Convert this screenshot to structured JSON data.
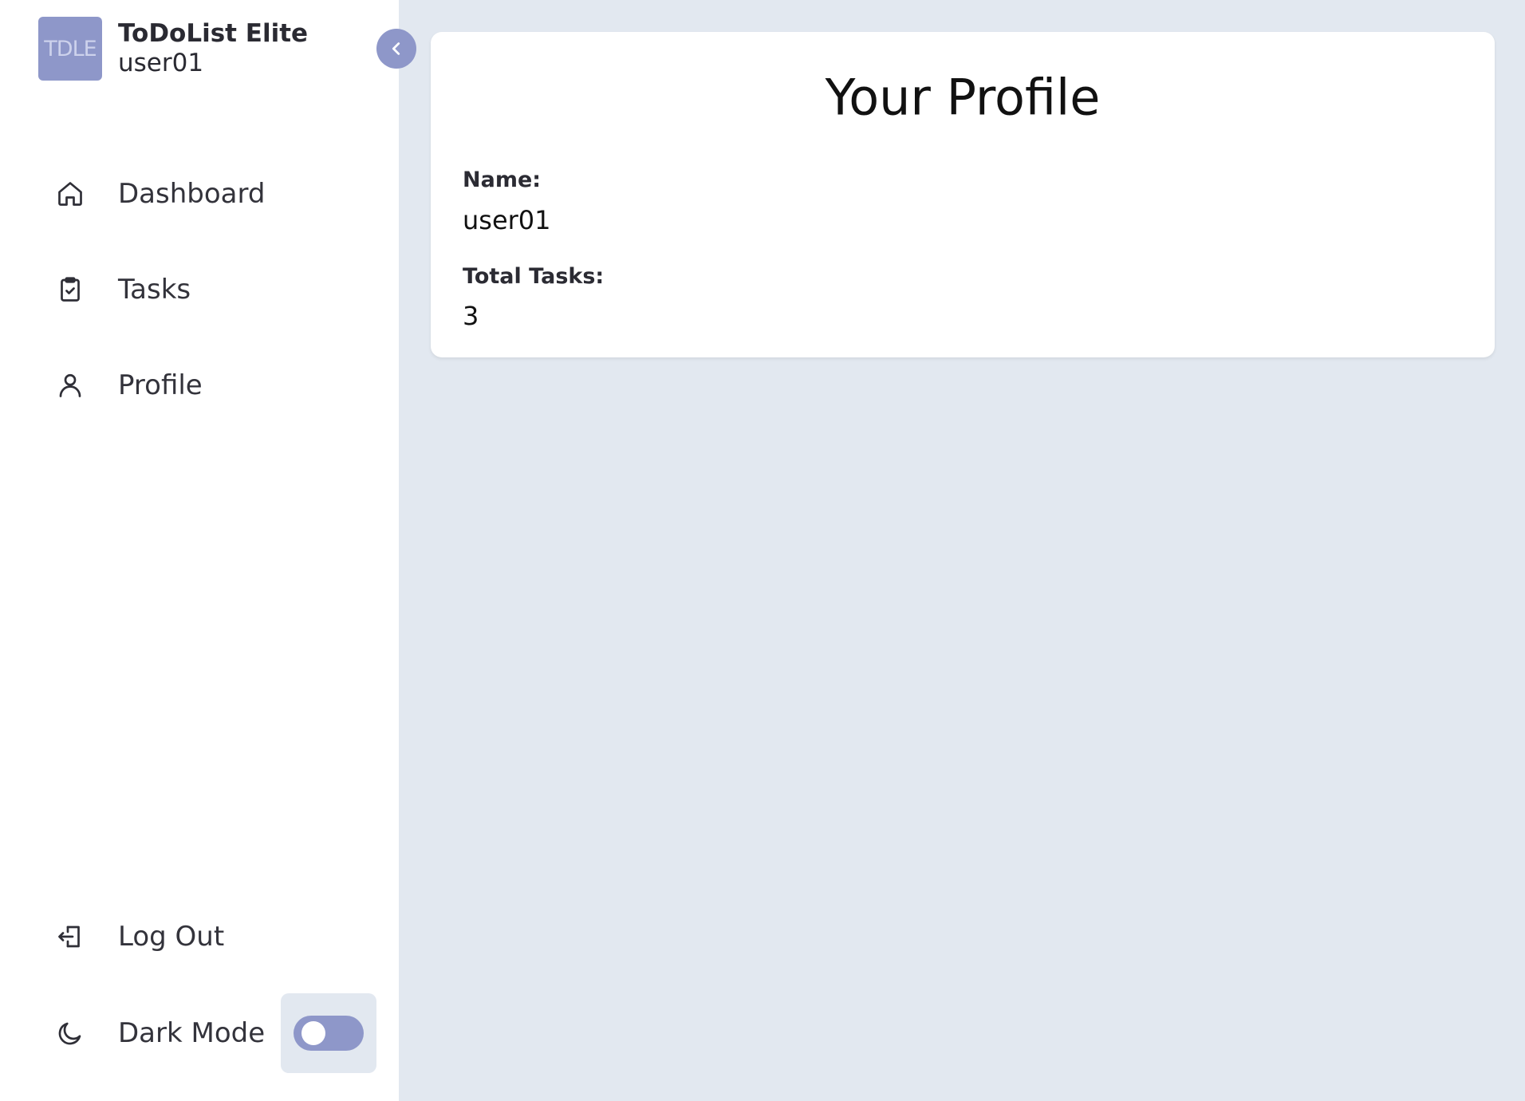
{
  "brand": {
    "logo_text": "TDLE",
    "title": "ToDoList Elite",
    "username": "user01"
  },
  "sidebar": {
    "collapse_icon": "chevron-left-icon",
    "items": [
      {
        "label": "Dashboard",
        "icon": "home-icon"
      },
      {
        "label": "Tasks",
        "icon": "clipboard-check-icon"
      },
      {
        "label": "Profile",
        "icon": "user-icon"
      }
    ],
    "logout": {
      "label": "Log Out",
      "icon": "logout-icon"
    },
    "dark_mode": {
      "label": "Dark Mode",
      "icon": "moon-icon",
      "enabled": false
    }
  },
  "profile": {
    "title": "Your Profile",
    "name_label": "Name:",
    "name_value": "user01",
    "tasks_label": "Total Tasks:",
    "tasks_value": "3"
  },
  "colors": {
    "accent": "#8e97c9",
    "background": "#e2e8f0",
    "surface": "#ffffff"
  }
}
